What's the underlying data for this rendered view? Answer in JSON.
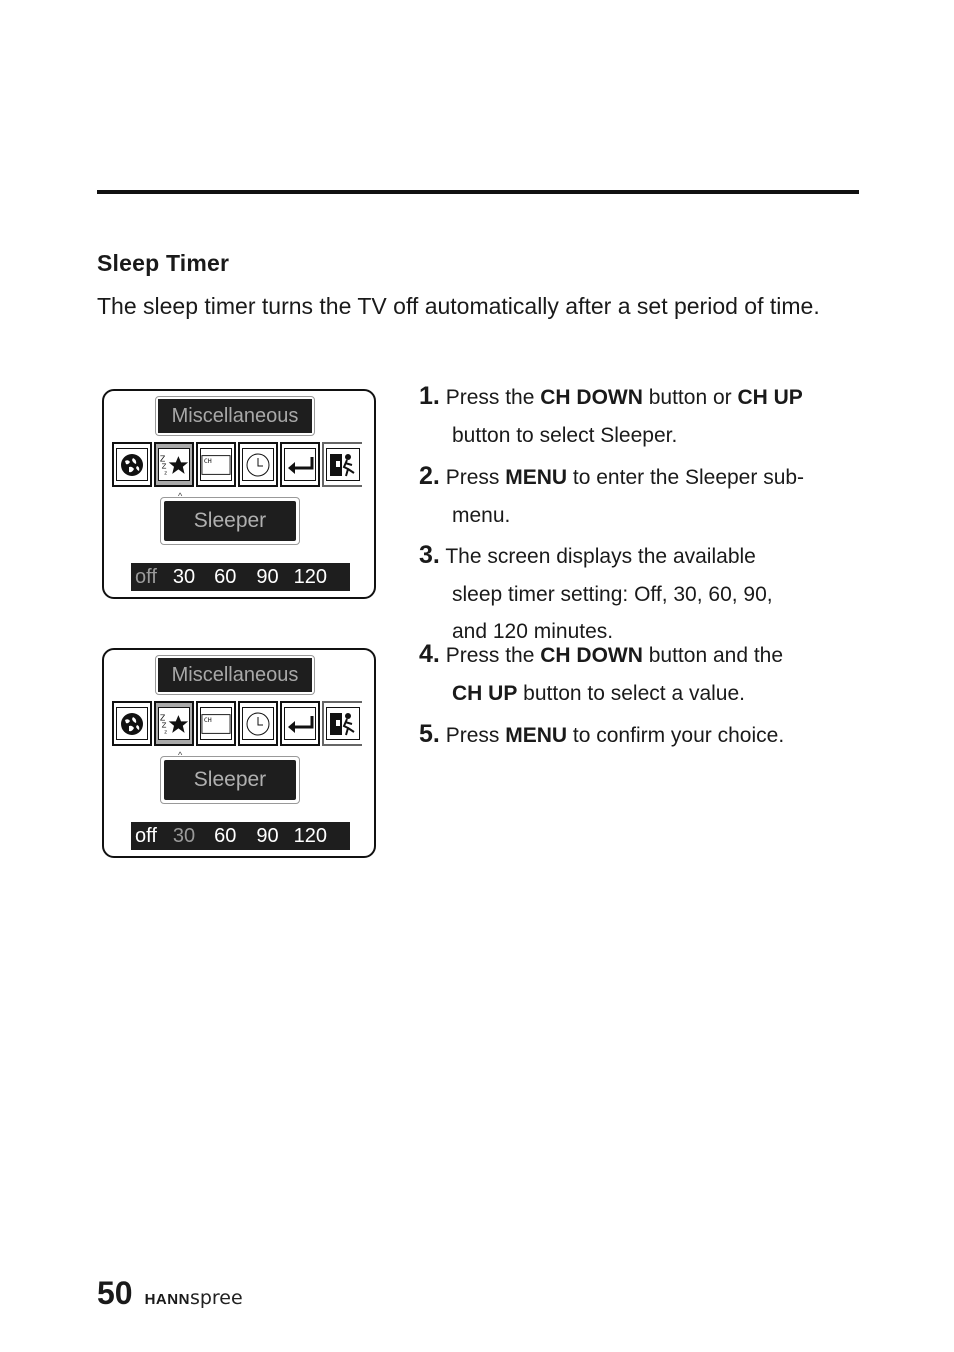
{
  "section": {
    "title": "Sleep Timer",
    "intro": "The sleep timer turns the TV off automatically after a set period of time."
  },
  "osd_screens": [
    {
      "title": "Miscellaneous",
      "icons": [
        "globe-icon",
        "sleep-star-icon",
        "channel-icon",
        "clock-icon",
        "return-icon",
        "exit-icon"
      ],
      "selected_icon": "sleep-star-icon",
      "submenu": "Sleeper",
      "values": [
        "off",
        "30",
        "60",
        "90",
        "120"
      ],
      "highlighted_value": "off"
    },
    {
      "title": "Miscellaneous",
      "icons": [
        "globe-icon",
        "sleep-star-icon",
        "channel-icon",
        "clock-icon",
        "return-icon",
        "exit-icon"
      ],
      "selected_icon": "sleep-star-icon",
      "submenu": "Sleeper",
      "values": [
        "off",
        "30",
        "60",
        "90",
        "120"
      ],
      "highlighted_value": "30"
    }
  ],
  "icon_labels": {
    "channel": "CH"
  },
  "steps": [
    {
      "num": "1.",
      "parts": [
        "Press the ",
        "CH DOWN",
        " button or ",
        "CH UP"
      ],
      "cont": "button to select Sleeper."
    },
    {
      "num": "2.",
      "parts": [
        "Press ",
        "MENU",
        " to enter the Sleeper sub-"
      ],
      "cont": "menu."
    },
    {
      "num": "3.",
      "parts": [
        "The screen displays the available"
      ],
      "cont": "sleep timer setting: Off, 30, 60, 90,",
      "cont2": "and 120 minutes."
    },
    {
      "num": "4.",
      "parts": [
        "Press the ",
        "CH DOWN",
        " button and the"
      ],
      "cont_bold": "CH UP",
      "cont": " button to select a value."
    },
    {
      "num": "5.",
      "parts": [
        "Press ",
        "MENU",
        " to confirm your choice."
      ]
    }
  ],
  "footer": {
    "page_number": "50",
    "brand_bold": "HANN",
    "brand_light": "spree"
  }
}
